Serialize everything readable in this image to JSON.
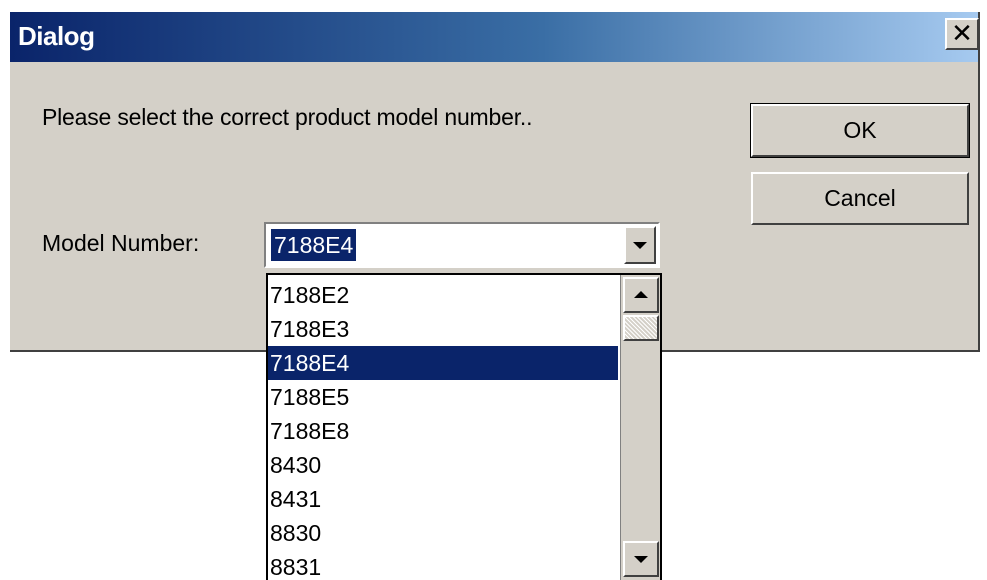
{
  "dialog": {
    "title": "Dialog",
    "close_label": "✕",
    "prompt": "Please  select  the correct product model number..",
    "ok_label": "OK",
    "cancel_label": "Cancel",
    "model_label": "Model Number:",
    "combo_value": "7188E4"
  },
  "dropdown": {
    "selected_index": 2,
    "items": [
      "7188E2",
      "7188E3",
      "7188E4",
      "7188E5",
      "7188E8",
      "8430",
      "8431",
      "8830",
      "8831"
    ]
  },
  "colors": {
    "titlebar_start": "#0a246a",
    "titlebar_end": "#a6caf0",
    "face": "#d4d0c8",
    "selection": "#0a246a"
  },
  "icons": {
    "close": "close-icon",
    "combo_arrow": "chevron-down-icon",
    "scroll_up": "scroll-up-arrow-icon",
    "scroll_down": "scroll-down-arrow-icon"
  }
}
